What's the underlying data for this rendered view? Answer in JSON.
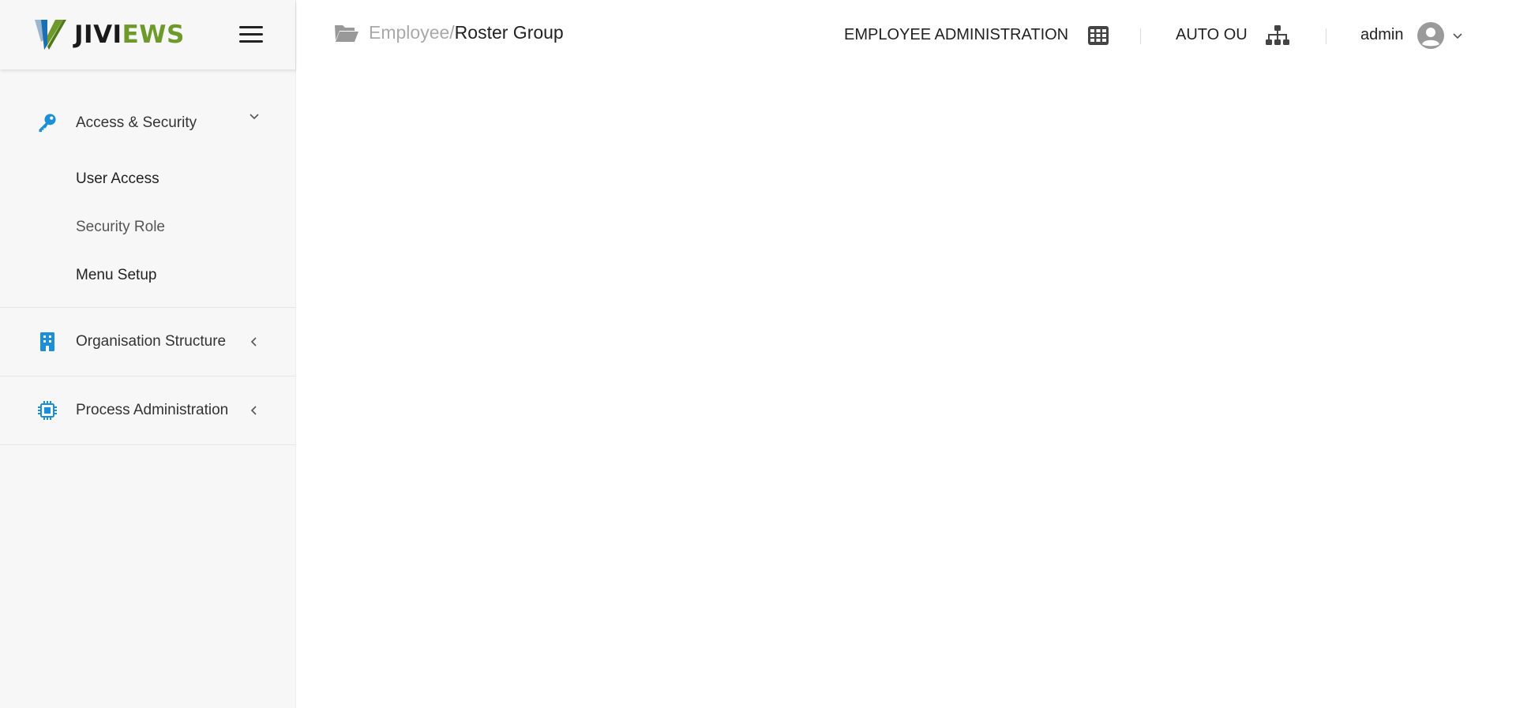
{
  "brand": {
    "name_part1": "JIVI",
    "name_part2": "EWS"
  },
  "breadcrumb": {
    "parent": "Employee",
    "separator": "/",
    "current": "Roster Group"
  },
  "header": {
    "module_label": "EMPLOYEE ADMINISTRATION",
    "org_label": "AUTO OU",
    "user_label": "admin"
  },
  "sidebar": {
    "groups": [
      {
        "label": "Access & Security",
        "icon": "key-icon",
        "expanded": true,
        "items": [
          {
            "label": "User Access"
          },
          {
            "label": "Security Role"
          },
          {
            "label": "Menu Setup"
          }
        ]
      },
      {
        "label": "Organisation Structure",
        "icon": "building-icon",
        "expanded": false
      },
      {
        "label": "Process Administration",
        "icon": "chip-icon",
        "expanded": false
      }
    ]
  },
  "colors": {
    "accent": "#1c8fd6",
    "brand_green": "#6e9a2c",
    "sidebar_bg": "#f7f7f7",
    "icon_dark": "#444444"
  }
}
